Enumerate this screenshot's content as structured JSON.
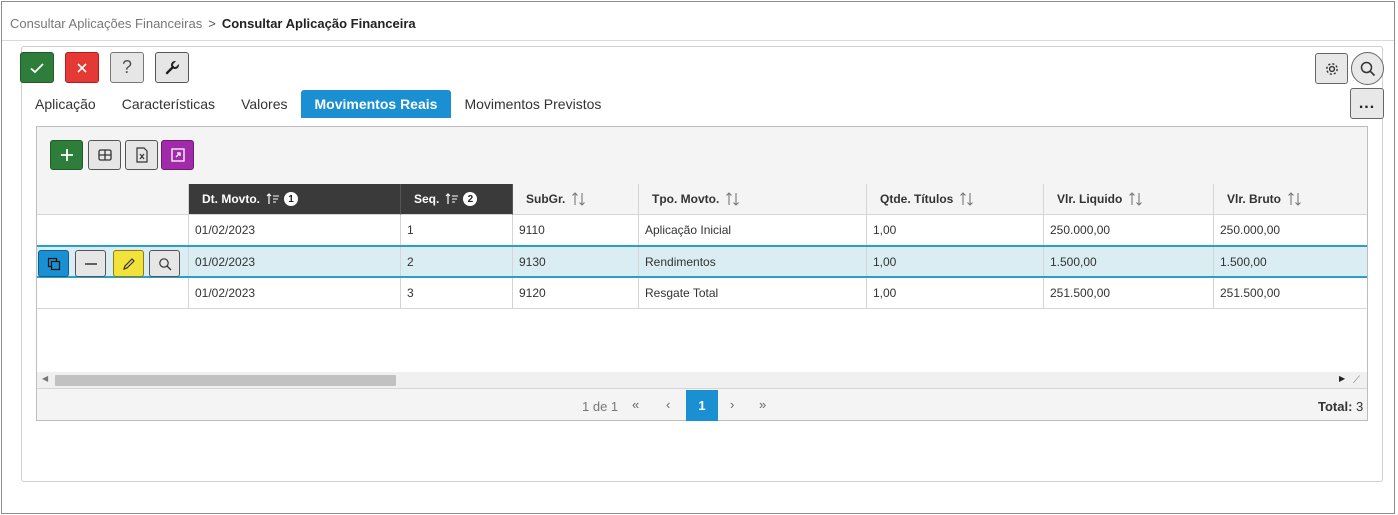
{
  "breadcrumb": {
    "parent": "Consultar Aplicações Financeiras",
    "separator": ">",
    "current": "Consultar Aplicação Financeira"
  },
  "toolbar": {
    "help_label": "?",
    "more_label": "..."
  },
  "tabs": [
    {
      "label": "Aplicação"
    },
    {
      "label": "Características"
    },
    {
      "label": "Valores"
    },
    {
      "label": "Movimentos Reais",
      "active": true
    },
    {
      "label": "Movimentos Previstos"
    }
  ],
  "grid": {
    "columns": [
      {
        "label": "Dt. Movto.",
        "sort_order": "1"
      },
      {
        "label": "Seq.",
        "sort_order": "2"
      },
      {
        "label": "SubGr."
      },
      {
        "label": "Tpo. Movto."
      },
      {
        "label": "Qtde. Títulos"
      },
      {
        "label": "Vlr. Liquido"
      },
      {
        "label": "Vlr. Bruto"
      }
    ],
    "rows": [
      {
        "dt": "01/02/2023",
        "seq": "1",
        "subgr": "9110",
        "tpo": "Aplicação Inicial",
        "qtde": "1,00",
        "liquido": "250.000,00",
        "bruto": "250.000,00"
      },
      {
        "dt": "01/02/2023",
        "seq": "2",
        "subgr": "9130",
        "tpo": "Rendimentos",
        "qtde": "1,00",
        "liquido": "1.500,00",
        "bruto": "1.500,00",
        "selected": true
      },
      {
        "dt": "01/02/2023",
        "seq": "3",
        "subgr": "9120",
        "tpo": "Resgate Total",
        "qtde": "1,00",
        "liquido": "251.500,00",
        "bruto": "251.500,00"
      }
    ]
  },
  "pager": {
    "info": "1 de 1",
    "current_page": "1",
    "first": "«",
    "prev": "‹",
    "next": "›",
    "last": "»",
    "total_label": "Total:",
    "total_value": "3"
  },
  "colors": {
    "accent": "#1a8fd1",
    "ok": "#2e7d3a",
    "cancel": "#e53935",
    "edit": "#f2e23a",
    "expand": "#a12aa8",
    "header_sorted": "#3a3a3a",
    "selected_row": "#d9edf2"
  }
}
